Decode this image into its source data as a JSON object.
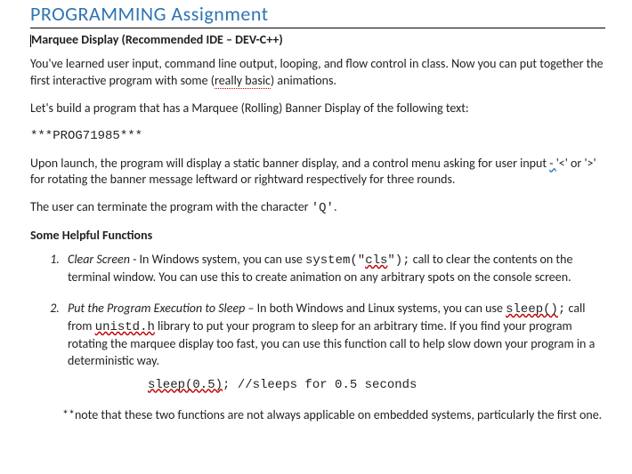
{
  "title": "PROGRAMMING Assignment",
  "subtitle": "Marquee Display (Recommended IDE – DEV-C++)",
  "intro1a": "You've learned user input, command line output, looping, and flow control in class.  Now you can put together the first interactive program with some (",
  "intro1b": "really basic",
  "intro1c": ") animations.",
  "intro2": "Let's build a program that has a Marquee (Rolling) Banner Display of the following text:",
  "banner": "***PROG71985***",
  "para2a": "Upon launch, the program will display a static banner display, and a control menu asking for user input ",
  "para2dash": "- ",
  "para2b": "'<' or '>' for rotating the banner message leftward or rightward respectively for three rounds.",
  "para3a": "The user can terminate the program with the character ",
  "para3b": "'Q'",
  "para3c": ".",
  "helpHead": "Some Helpful Functions",
  "li1": {
    "title": "Clear Screen",
    "a": " - In Windows system, you can use ",
    "code1": "system(\"",
    "cls": "cls",
    "code2": "\");",
    "b": " call to clear the contents on the terminal window.  You can use this to create animation on any arbitrary spots on the console screen."
  },
  "li2": {
    "title": "Put the Program Execution to Sleep",
    "a": " – In both Windows and Linux systems, you can use ",
    "sleep": "sleep()",
    "semi": ";",
    "b": " call from ",
    "unistd": "unistd.h",
    "c": " library to put your program to sleep for an arbitrary time.   If you find your program rotating the marquee display too fast, you can use this function call to help slow down your program in a deterministic way."
  },
  "codeline": {
    "a": "sleep(0.5)",
    "b": ";   //sleeps for 0.5 seconds"
  },
  "note": "**note that these two functions are not always applicable on embedded systems, particularly the first one."
}
